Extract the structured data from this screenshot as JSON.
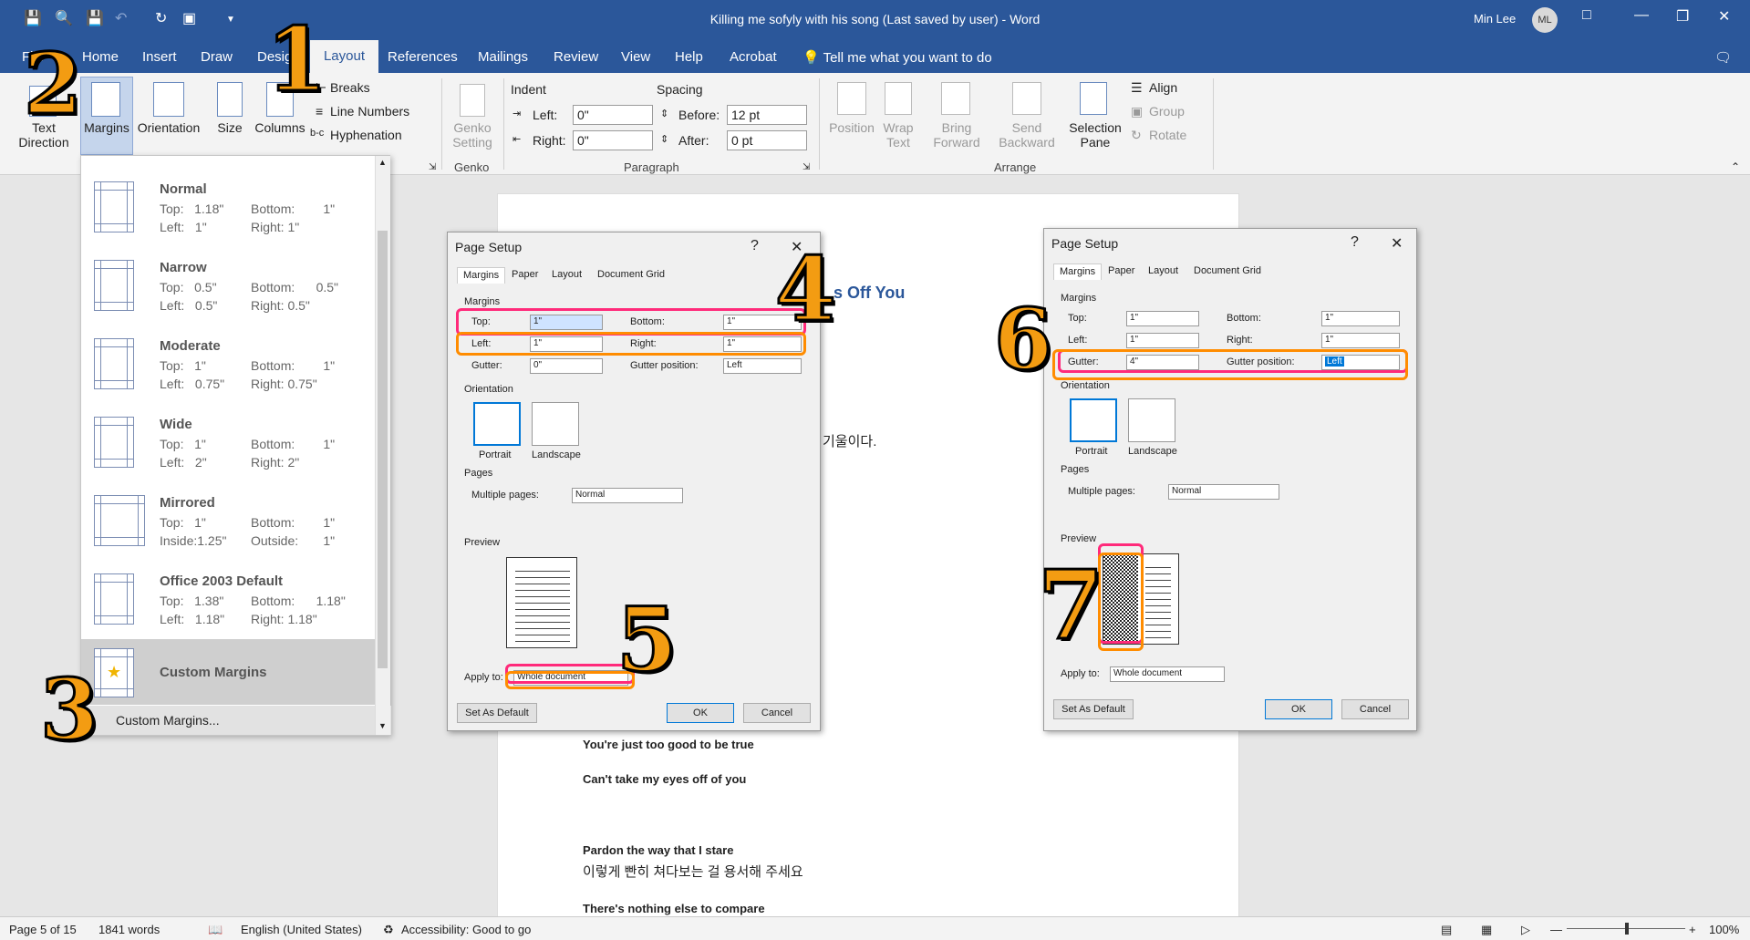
{
  "window": {
    "title": "Killing me sofyly with his song (Last saved by user)  -  Word",
    "user_name": "Min Lee",
    "user_initials": "ML"
  },
  "menu": {
    "tabs": [
      "File",
      "Home",
      "Insert",
      "Draw",
      "Design",
      "Layout",
      "References",
      "Mailings",
      "Review",
      "View",
      "Help",
      "Acrobat"
    ],
    "tell_me": "Tell me what you want to do"
  },
  "ribbon": {
    "text_direction": "Text\nDirection",
    "margins": "Margins",
    "orientation": "Orientation",
    "size": "Size",
    "columns": "Columns",
    "breaks": "Breaks",
    "line_numbers": "Line Numbers",
    "hyphenation": "Hyphenation",
    "genko_setting": "Genko\nSetting",
    "genko_group": "Genko",
    "indent_label": "Indent",
    "indent_left_label": "Left:",
    "indent_left_value": "0\"",
    "indent_right_label": "Right:",
    "indent_right_value": "0\"",
    "spacing_label": "Spacing",
    "before_label": "Before:",
    "before_value": "12 pt",
    "after_label": "After:",
    "after_value": "0 pt",
    "paragraph_group": "Paragraph",
    "position": "Position",
    "wrap_text": "Wrap\nText",
    "bring_forward": "Bring\nForward",
    "send_backward": "Send\nBackward",
    "selection_pane": "Selection\nPane",
    "align": "Align",
    "group": "Group",
    "rotate": "Rotate",
    "arrange_group": "Arrange"
  },
  "margins_menu": {
    "items": [
      {
        "name": "Normal",
        "r1a": "Top:   1.18\"",
        "r1b": "Bottom:        1\"",
        "r2a": "Left:   1\"",
        "r2b": "Right: 1\""
      },
      {
        "name": "Narrow",
        "r1a": "Top:   0.5\"",
        "r1b": "Bottom:      0.5\"",
        "r2a": "Left:   0.5\"",
        "r2b": "Right: 0.5\""
      },
      {
        "name": "Moderate",
        "r1a": "Top:   1\"",
        "r1b": "Bottom:        1\"",
        "r2a": "Left:   0.75\"",
        "r2b": "Right: 0.75\""
      },
      {
        "name": "Wide",
        "r1a": "Top:   1\"",
        "r1b": "Bottom:        1\"",
        "r2a": "Left:   2\"",
        "r2b": "Right: 2\""
      },
      {
        "name": "Mirrored",
        "r1a": "Top:   1\"",
        "r1b": "Bottom:        1\"",
        "r2a": "Inside:1.25\"",
        "r2b": "Outside:       1\""
      },
      {
        "name": "Office 2003 Default",
        "r1a": "Top:   1.38\"",
        "r1b": "Bottom:      1.18\"",
        "r2a": "Left:   1.18\"",
        "r2b": "Right: 1.18\""
      }
    ],
    "custom_title": "Custom Margins",
    "custom_link": "Custom Margins..."
  },
  "dialog1": {
    "title": "Page Setup",
    "help": "?",
    "tabs": [
      "Margins",
      "Paper",
      "Layout",
      "Document Grid"
    ],
    "margins_section": "Margins",
    "top_label": "Top:",
    "top_value": "1\"",
    "bottom_label": "Bottom:",
    "bottom_value": "1\"",
    "left_label": "Left:",
    "left_value": "1\"",
    "right_label": "Right:",
    "right_value": "1\"",
    "gutter_label": "Gutter:",
    "gutter_value": "0\"",
    "gutter_pos_label": "Gutter position:",
    "gutter_pos_value": "Left",
    "orientation_section": "Orientation",
    "portrait": "Portrait",
    "landscape": "Landscape",
    "pages_section": "Pages",
    "multiple_pages_label": "Multiple pages:",
    "multiple_pages_value": "Normal",
    "preview_section": "Preview",
    "apply_to_label": "Apply to:",
    "apply_to_value": "Whole document",
    "set_default": "Set As Default",
    "ok": "OK",
    "cancel": "Cancel"
  },
  "dialog2": {
    "title": "Page Setup",
    "help": "?",
    "tabs": [
      "Margins",
      "Paper",
      "Layout",
      "Document Grid"
    ],
    "margins_section": "Margins",
    "top_label": "Top:",
    "top_value": "1\"",
    "bottom_label": "Bottom:",
    "bottom_value": "1\"",
    "left_label": "Left:",
    "left_value": "1\"",
    "right_label": "Right:",
    "right_value": "1\"",
    "gutter_label": "Gutter:",
    "gutter_value": "4\"",
    "gutter_pos_label": "Gutter position:",
    "gutter_pos_value": "Left",
    "orientation_section": "Orientation",
    "portrait": "Portrait",
    "landscape": "Landscape",
    "pages_section": "Pages",
    "multiple_pages_label": "Multiple pages:",
    "multiple_pages_value": "Normal",
    "preview_section": "Preview",
    "apply_to_label": "Apply to:",
    "apply_to_value": "Whole document",
    "set_default": "Set As Default",
    "ok": "OK",
    "cancel": "Cancel"
  },
  "document": {
    "heading_fragment": "s Off You",
    "korean_fragment": "기울이다.",
    "line1": "You're just too good to be true",
    "line2": "Can't take my eyes off of you",
    "line3": "Pardon the way that I stare",
    "line4": "이렇게 빤히 쳐다보는 걸 용서해 주세요",
    "line5": "There's nothing else to compare"
  },
  "status": {
    "page": "Page 5 of 15",
    "words": "1841 words",
    "language": "English (United States)",
    "accessibility": "Accessibility: Good to go",
    "zoom": "100%"
  },
  "callouts": [
    "1",
    "2",
    "3",
    "4",
    "5",
    "6",
    "7"
  ],
  "colors": {
    "accent": "#2b579a",
    "pink": "#ff2a7a",
    "orange": "#ff8c00",
    "callout": "#f39c12"
  }
}
